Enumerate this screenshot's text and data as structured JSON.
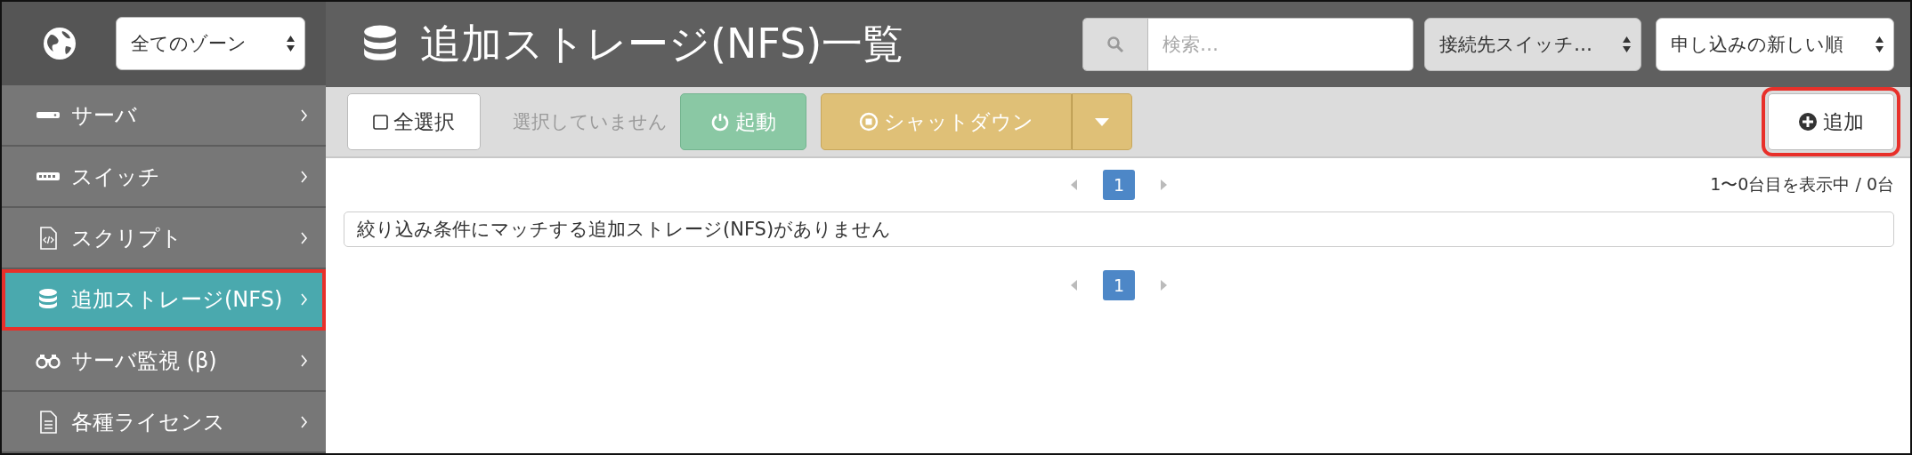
{
  "sidebar": {
    "zone_select": {
      "value": "全てのゾーン"
    },
    "items": [
      {
        "kind": "server",
        "label": "サーバ",
        "selected": false,
        "highlighted": false
      },
      {
        "kind": "switch",
        "label": "スイッチ",
        "selected": false,
        "highlighted": false
      },
      {
        "kind": "script",
        "label": "スクリプト",
        "selected": false,
        "highlighted": false
      },
      {
        "kind": "storage",
        "label": "追加ストレージ(NFS)",
        "selected": true,
        "highlighted": true
      },
      {
        "kind": "monitor",
        "label": "サーバ監視 (β)",
        "selected": false,
        "highlighted": false
      },
      {
        "kind": "license",
        "label": "各種ライセンス",
        "selected": false,
        "highlighted": false
      }
    ]
  },
  "header": {
    "title": "追加ストレージ(NFS)一覧",
    "search": {
      "placeholder": "検索…"
    },
    "switch_filter": {
      "value": "接続先スイッチ…"
    },
    "sort": {
      "value": "申し込みの新しい順"
    }
  },
  "toolbar": {
    "select_all": {
      "label": "全選択",
      "checked": false
    },
    "selection_status": "選択していません",
    "start": {
      "label": "起動"
    },
    "shutdown": {
      "label": "シャットダウン"
    },
    "add": {
      "label": "追加",
      "highlighted": true
    }
  },
  "pagination_top": {
    "pages": [
      {
        "label": "1",
        "selected": true
      }
    ],
    "summary": "1〜0台目を表示中 / 0台"
  },
  "message": "絞り込み条件にマッチする追加ストレージ(NFS)がありません",
  "pagination_bottom": {
    "pages": [
      {
        "label": "1",
        "selected": true
      }
    ]
  }
}
